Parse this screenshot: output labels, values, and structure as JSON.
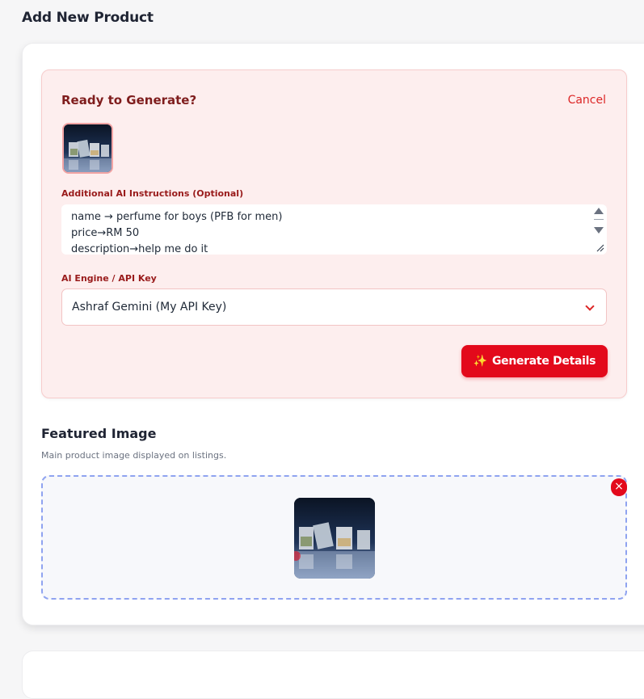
{
  "page": {
    "title": "Add New Product"
  },
  "ai_panel": {
    "title": "Ready to Generate?",
    "cancel_label": "Cancel",
    "instructions_label": "Additional AI Instructions (Optional)",
    "instructions_lines": [
      "name → perfume for boys (PFB for men)",
      "price→RM 50",
      "description→help me do it"
    ],
    "engine_label": "AI Engine / API Key",
    "engine_selected": "Ashraf Gemini (My API Key)",
    "generate_label": "Generate Details",
    "generate_icon": "✨"
  },
  "featured_image": {
    "title": "Featured Image",
    "subtitle": "Main product image displayed on listings.",
    "remove_icon": "×"
  },
  "colors": {
    "accent": "#e3091b",
    "panel_bg": "#fdeeee",
    "dropzone_border": "#8fa3f0"
  }
}
